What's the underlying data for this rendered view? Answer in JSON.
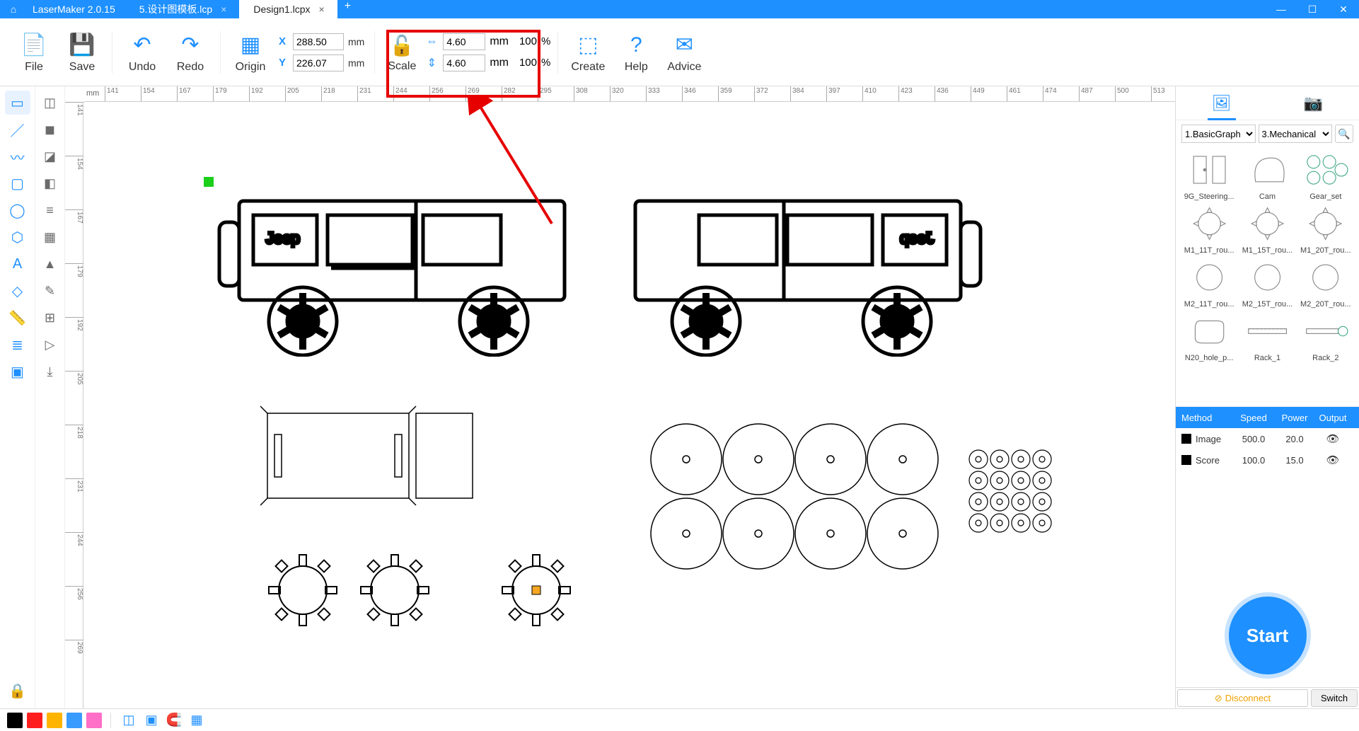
{
  "app": {
    "name": "LaserMaker 2.0.15"
  },
  "tabs": [
    {
      "label": "5.设计图模板.lcp",
      "active": false
    },
    {
      "label": "Design1.lcpx",
      "active": true
    }
  ],
  "toolbar": {
    "file": "File",
    "save": "Save",
    "undo": "Undo",
    "redo": "Redo",
    "origin": "Origin",
    "scale": "Scale",
    "create": "Create",
    "help": "Help",
    "advice": "Advice"
  },
  "coords": {
    "x_label": "X",
    "x_value": "288.50",
    "x_unit": "mm",
    "y_label": "Y",
    "y_value": "226.07",
    "y_unit": "mm"
  },
  "scale": {
    "w_value": "4.60",
    "w_unit": "mm",
    "w_pct": "100",
    "w_sym": "%",
    "h_value": "4.60",
    "h_unit": "mm",
    "h_pct": "100",
    "h_sym": "%"
  },
  "ruler": {
    "unit": "mm",
    "h_ticks": [
      141,
      154,
      167,
      179,
      192,
      205,
      218,
      231,
      244,
      256,
      269,
      282,
      295,
      308,
      320,
      333,
      346,
      359,
      372,
      384,
      397,
      410,
      423,
      436,
      449,
      461,
      474,
      487,
      500,
      513
    ],
    "v_ticks": [
      141,
      154,
      167,
      179,
      192,
      205,
      218,
      231,
      244,
      256,
      269
    ]
  },
  "library": {
    "cat1": "1.BasicGraph",
    "cat2": "3.Mechanical",
    "items": [
      "9G_Steering...",
      "Cam",
      "Gear_set",
      "M1_11T_rou...",
      "M1_15T_rou...",
      "M1_20T_rou...",
      "M2_11T_rou...",
      "M2_15T_rou...",
      "M2_20T_rou...",
      "N20_hole_p...",
      "Rack_1",
      "Rack_2"
    ]
  },
  "layers": {
    "headers": {
      "method": "Method",
      "speed": "Speed",
      "power": "Power",
      "output": "Output"
    },
    "rows": [
      {
        "name": "Image",
        "speed": "500.0",
        "power": "20.0"
      },
      {
        "name": "Score",
        "speed": "100.0",
        "power": "15.0"
      }
    ]
  },
  "start": "Start",
  "connection": {
    "disconnect": "Disconnect",
    "switch": "Switch"
  },
  "swatches": [
    "#000000",
    "#ff1e1e",
    "#ffb400",
    "#3a9bff",
    "#ff6ec7"
  ]
}
